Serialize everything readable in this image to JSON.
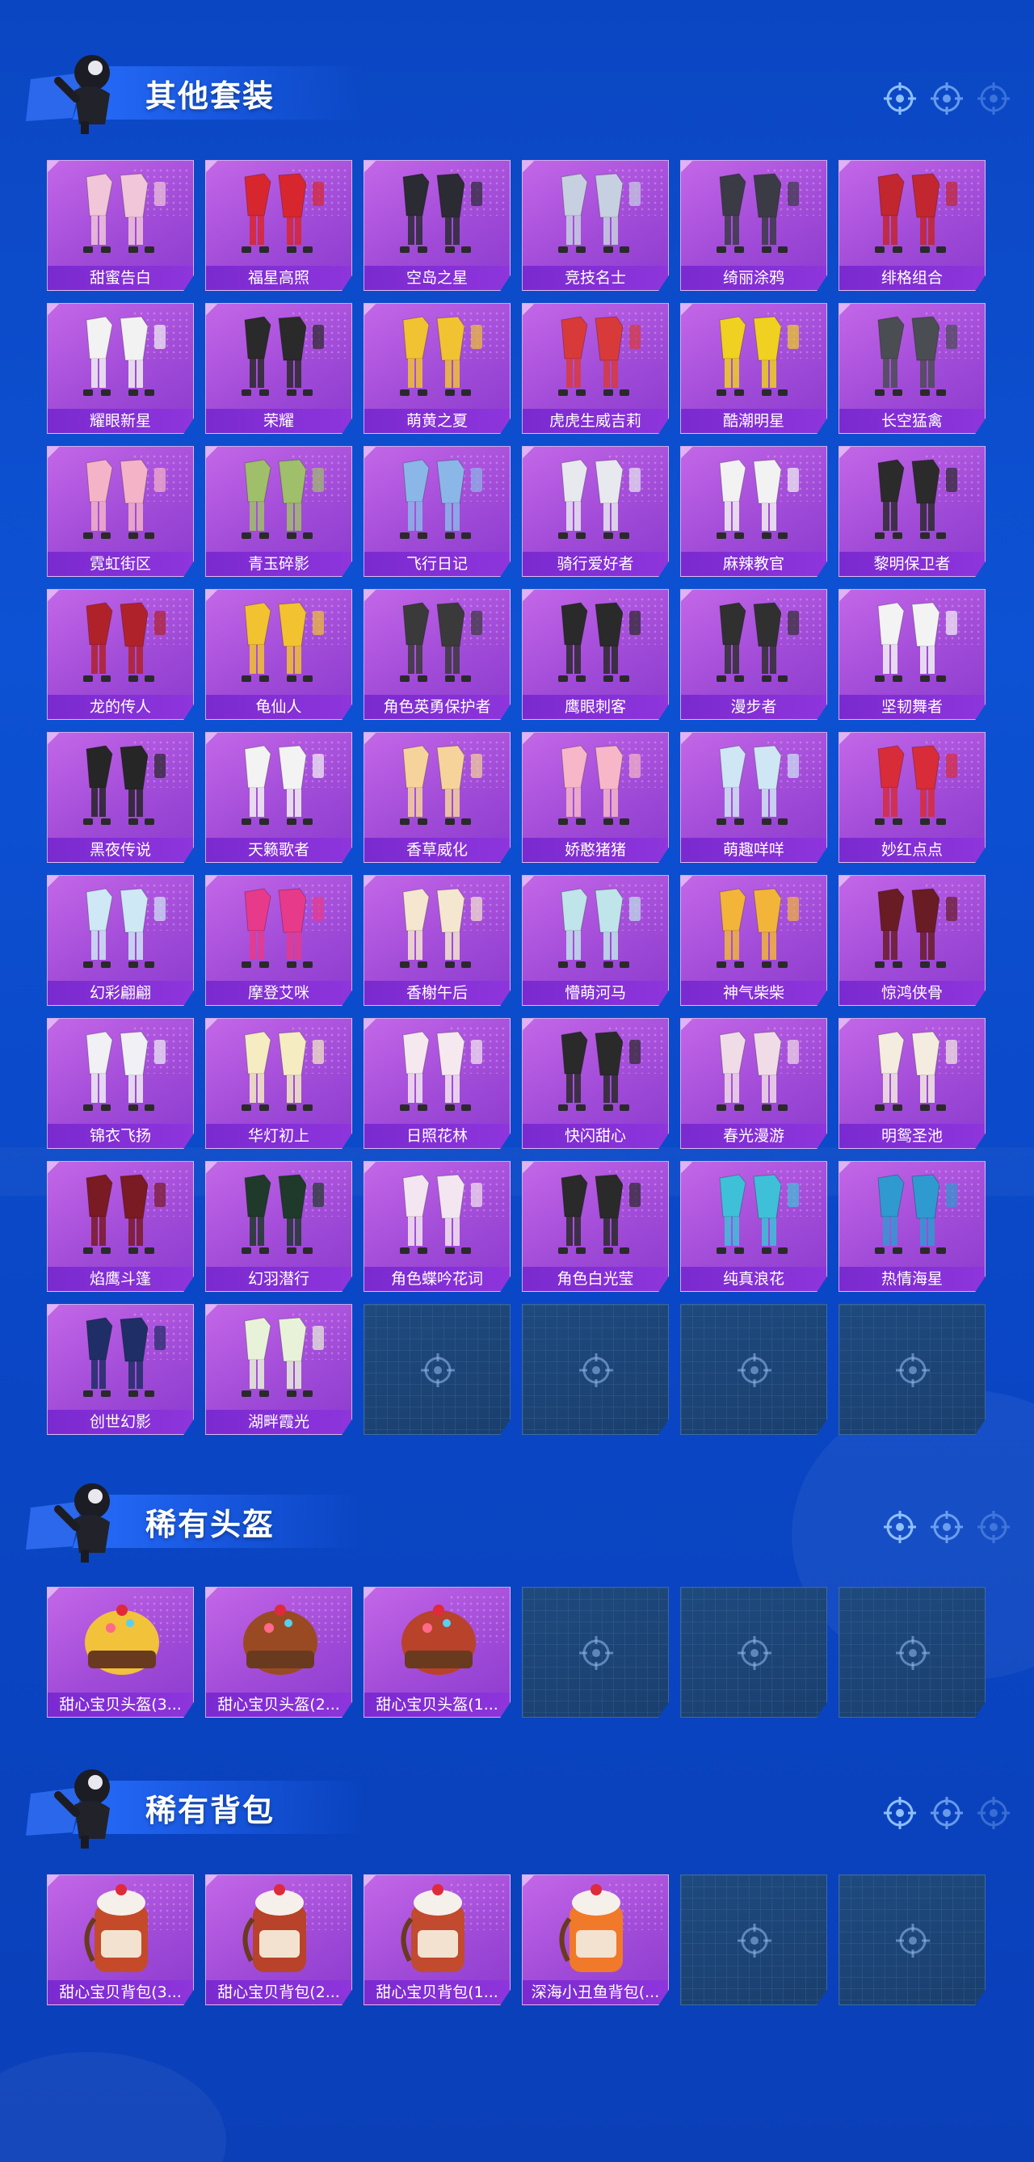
{
  "sections": [
    {
      "title": "其他套装",
      "items": [
        {
          "name": "甜蜜告白",
          "tone": "#f0c6d8",
          "kind": "outfit"
        },
        {
          "name": "福星高照",
          "tone": "#d8262e",
          "kind": "outfit"
        },
        {
          "name": "空岛之星",
          "tone": "#2b2b33",
          "kind": "outfit"
        },
        {
          "name": "竞技名士",
          "tone": "#c7d0e0",
          "kind": "outfit"
        },
        {
          "name": "绮丽涂鸦",
          "tone": "#3b3b45",
          "kind": "outfit"
        },
        {
          "name": "绯格组合",
          "tone": "#c2262e",
          "kind": "outfit"
        },
        {
          "name": "耀眼新星",
          "tone": "#f2f2f2",
          "kind": "outfit"
        },
        {
          "name": "荣耀",
          "tone": "#2a2a2a",
          "kind": "outfit"
        },
        {
          "name": "萌黄之夏",
          "tone": "#f1c232",
          "kind": "outfit"
        },
        {
          "name": "虎虎生威吉莉",
          "tone": "#d83a3a",
          "kind": "outfit"
        },
        {
          "name": "酷潮明星",
          "tone": "#f0d020",
          "kind": "outfit"
        },
        {
          "name": "长空猛禽",
          "tone": "#4a4d52",
          "kind": "outfit"
        },
        {
          "name": "霓虹街区",
          "tone": "#f5b3c8",
          "kind": "outfit"
        },
        {
          "name": "青玉碎影",
          "tone": "#9fbf6a",
          "kind": "outfit"
        },
        {
          "name": "飞行日记",
          "tone": "#8bb6e8",
          "kind": "outfit"
        },
        {
          "name": "骑行爱好者",
          "tone": "#e8e8ef",
          "kind": "outfit"
        },
        {
          "name": "麻辣教官",
          "tone": "#f2f2f2",
          "kind": "outfit"
        },
        {
          "name": "黎明保卫者",
          "tone": "#2b2b2b",
          "kind": "outfit"
        },
        {
          "name": "龙的传人",
          "tone": "#b0222a",
          "kind": "outfit"
        },
        {
          "name": "龟仙人",
          "tone": "#f2c230",
          "kind": "outfit"
        },
        {
          "name": "角色英勇保护者",
          "tone": "#3a3a3a",
          "kind": "outfit"
        },
        {
          "name": "鹰眼刺客",
          "tone": "#2a2a2a",
          "kind": "outfit"
        },
        {
          "name": "漫步者",
          "tone": "#303030",
          "kind": "outfit"
        },
        {
          "name": "坚韧舞者",
          "tone": "#f3f3f3",
          "kind": "outfit"
        },
        {
          "name": "黑夜传说",
          "tone": "#262626",
          "kind": "outfit"
        },
        {
          "name": "天籁歌者",
          "tone": "#f3f3f3",
          "kind": "outfit"
        },
        {
          "name": "香草威化",
          "tone": "#f6d39a",
          "kind": "outfit"
        },
        {
          "name": "娇憨猪猪",
          "tone": "#f7b7c8",
          "kind": "outfit"
        },
        {
          "name": "萌趣咩咩",
          "tone": "#cfe6f5",
          "kind": "outfit"
        },
        {
          "name": "妙红点点",
          "tone": "#d82c38",
          "kind": "outfit"
        },
        {
          "name": "幻彩翩翩",
          "tone": "#cfe8f6",
          "kind": "outfit"
        },
        {
          "name": "摩登艾咪",
          "tone": "#e83a8a",
          "kind": "outfit"
        },
        {
          "name": "香榭午后",
          "tone": "#f5e6cf",
          "kind": "outfit"
        },
        {
          "name": "懵萌河马",
          "tone": "#bfe4ea",
          "kind": "outfit"
        },
        {
          "name": "神气柴柴",
          "tone": "#f2b53a",
          "kind": "outfit"
        },
        {
          "name": "惊鸿侠骨",
          "tone": "#6a1c24",
          "kind": "outfit"
        },
        {
          "name": "锦衣飞扬",
          "tone": "#f0f0f5",
          "kind": "outfit"
        },
        {
          "name": "华灯初上",
          "tone": "#f5ecc2",
          "kind": "outfit"
        },
        {
          "name": "日照花林",
          "tone": "#f5e8ef",
          "kind": "outfit"
        },
        {
          "name": "快闪甜心",
          "tone": "#2a2a2a",
          "kind": "outfit"
        },
        {
          "name": "春光漫游",
          "tone": "#f0dce6",
          "kind": "outfit"
        },
        {
          "name": "明鸳圣池",
          "tone": "#f3ecdf",
          "kind": "outfit"
        },
        {
          "name": "焰鹰斗篷",
          "tone": "#7a1a22",
          "kind": "outfit"
        },
        {
          "name": "幻羽潜行",
          "tone": "#1f3a2a",
          "kind": "outfit"
        },
        {
          "name": "角色蝶吟花词",
          "tone": "#f3e6f0",
          "kind": "outfit"
        },
        {
          "name": "角色白光莹",
          "tone": "#2a2a2a",
          "kind": "outfit"
        },
        {
          "name": "纯真浪花",
          "tone": "#3ec0d8",
          "kind": "outfit"
        },
        {
          "name": "热情海星",
          "tone": "#2f9ad0",
          "kind": "outfit"
        },
        {
          "name": "创世幻影",
          "tone": "#1f2e66",
          "kind": "outfit"
        },
        {
          "name": "湖畔霞光",
          "tone": "#e8f2d8",
          "kind": "outfit"
        },
        {
          "name": "",
          "tone": "",
          "kind": "empty"
        },
        {
          "name": "",
          "tone": "",
          "kind": "empty"
        },
        {
          "name": "",
          "tone": "",
          "kind": "empty"
        },
        {
          "name": "",
          "tone": "",
          "kind": "empty"
        }
      ]
    },
    {
      "title": "稀有头盔",
      "items": [
        {
          "name": "甜心宝贝头盔(3...",
          "tone": "#f2c23a",
          "kind": "helmet"
        },
        {
          "name": "甜心宝贝头盔(2...",
          "tone": "#9a4a22",
          "kind": "helmet"
        },
        {
          "name": "甜心宝贝头盔(1...",
          "tone": "#b8422a",
          "kind": "helmet"
        },
        {
          "name": "",
          "tone": "",
          "kind": "empty"
        },
        {
          "name": "",
          "tone": "",
          "kind": "empty"
        },
        {
          "name": "",
          "tone": "",
          "kind": "empty"
        }
      ]
    },
    {
      "title": "稀有背包",
      "items": [
        {
          "name": "甜心宝贝背包(3...",
          "tone": "#c44a2a",
          "kind": "backpack"
        },
        {
          "name": "甜心宝贝背包(2...",
          "tone": "#b8422a",
          "kind": "backpack"
        },
        {
          "name": "甜心宝贝背包(1...",
          "tone": "#c24a2e",
          "kind": "backpack"
        },
        {
          "name": "深海小丑鱼背包(...",
          "tone": "#f07a2a",
          "kind": "backpack"
        },
        {
          "name": "",
          "tone": "",
          "kind": "empty"
        },
        {
          "name": "",
          "tone": "",
          "kind": "empty"
        }
      ]
    }
  ]
}
